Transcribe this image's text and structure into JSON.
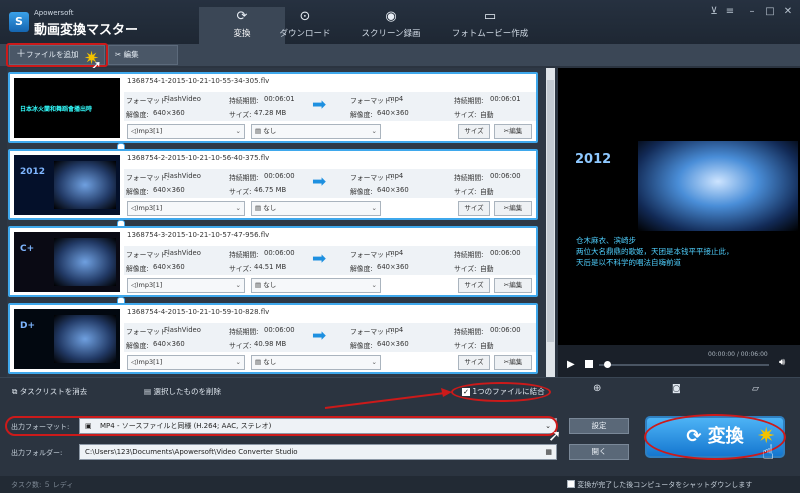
{
  "app": {
    "brand_small": "Apowersoft",
    "brand_big": "動画変換マスター"
  },
  "tabs": [
    {
      "label": "変換",
      "icon": "refresh-icon",
      "active": true
    },
    {
      "label": "ダウンロード",
      "icon": "download-icon",
      "active": false
    },
    {
      "label": "スクリーン録画",
      "icon": "record-icon",
      "active": false
    },
    {
      "label": "フォトムービー作成",
      "icon": "tv-icon",
      "active": false
    }
  ],
  "toolbar": {
    "add_file": "ファイルを追加",
    "edit": "編集"
  },
  "labels": {
    "format": "フォーマット:",
    "duration": "持続期間:",
    "resolution": "解像度:",
    "size": "サイズ:"
  },
  "items": [
    {
      "filename": "1368754-1-2015-10-21-10-55-34-305.flv",
      "src_format": "FlashVideo",
      "src_duration": "00:06:01",
      "src_res": "640×360",
      "src_size": "47.28 MB",
      "dst_format": "mp4",
      "dst_duration": "00:06:01",
      "dst_res": "640×360",
      "dst_size": "自動",
      "audio": "mp3[1]",
      "subtitle": "なし",
      "size_btn": "サイズ",
      "edit_btn": "編集",
      "thumb_text": "日本冰火蘭和舞蹈會播出時"
    },
    {
      "filename": "1368754-2-2015-10-21-10-56-40-375.flv",
      "src_format": "FlashVideo",
      "src_duration": "00:06:00",
      "src_res": "640×360",
      "src_size": "46.75 MB",
      "dst_format": "mp4",
      "dst_duration": "00:06:00",
      "dst_res": "640×360",
      "dst_size": "自動",
      "audio": "mp3[1]",
      "subtitle": "なし",
      "size_btn": "サイズ",
      "edit_btn": "編集",
      "thumb_text": "2012"
    },
    {
      "filename": "1368754-3-2015-10-21-10-57-47-956.flv",
      "src_format": "FlashVideo",
      "src_duration": "00:06:00",
      "src_res": "640×360",
      "src_size": "44.51 MB",
      "dst_format": "mp4",
      "dst_duration": "00:06:00",
      "dst_res": "640×360",
      "dst_size": "自動",
      "audio": "mp3[1]",
      "subtitle": "なし",
      "size_btn": "サイズ",
      "edit_btn": "編集",
      "thumb_text": "C+"
    },
    {
      "filename": "1368754-4-2015-10-21-10-59-10-828.flv",
      "src_format": "FlashVideo",
      "src_duration": "00:06:00",
      "src_res": "640×360",
      "src_size": "40.98 MB",
      "dst_format": "mp4",
      "dst_duration": "00:06:00",
      "dst_res": "640×360",
      "dst_size": "自動",
      "audio": "mp3[1]",
      "subtitle": "なし",
      "size_btn": "サイズ",
      "edit_btn": "編集",
      "thumb_text": "D+"
    }
  ],
  "preview": {
    "title": "2012",
    "caption1": "仓木麻衣、滨崎步",
    "caption2": "两位大名鼎鼎的歌姬，天团是本钱平平接止此，",
    "caption3": "天后是以不科学的唱法自嗨前道",
    "time": "00:00:00 / 00:06:00"
  },
  "bottom": {
    "clear_list": "タスクリストを消去",
    "delete_selected": "選択したものを削除",
    "merge": "1つのファイルに結合",
    "merge_checked": true
  },
  "output": {
    "format_label": "出力フォーマット:",
    "format_value": "MP4 - ソースファイルと同様 (H.264; AAC, ステレオ)",
    "settings": "設定",
    "folder_label": "出力フォルダー:",
    "folder_value": "C:\\Users\\123\\Documents\\Apowersoft\\Video Converter Studio",
    "open": "開く",
    "convert": "変換"
  },
  "status": {
    "task": "タスク数: ５ レディ",
    "shutdown": "変換が完了した後コンピュータをシャットダウンします"
  },
  "colors": {
    "accent": "#3fa8ec",
    "annotation": "#cc1a1a"
  }
}
